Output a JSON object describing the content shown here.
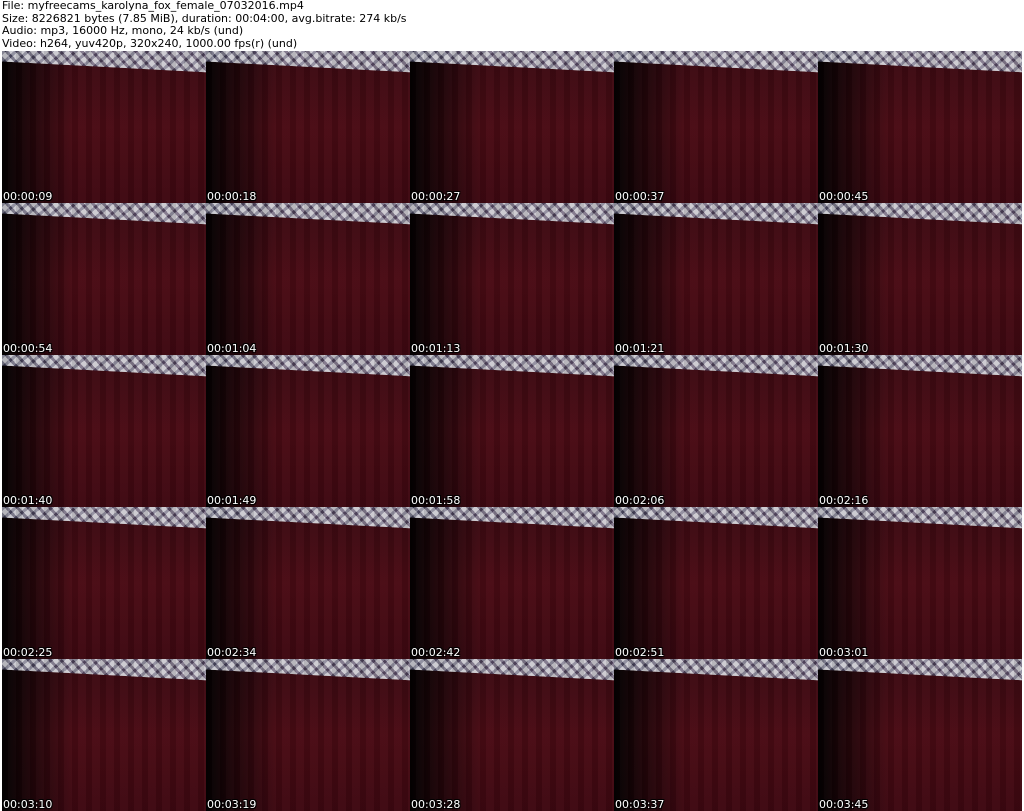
{
  "header": {
    "file_line": "File: myfreecams_karolyna_fox_female_07032016.mp4",
    "size_line": "Size: 8226821 bytes (7.85 MiB), duration: 00:04:00, avg.bitrate: 274 kb/s",
    "audio_line": "Audio: mp3, 16000 Hz, mono, 24 kb/s (und)",
    "video_line": "Video: h264, yuv420p, 320x240, 1000.00 fps(r) (und)"
  },
  "thumbnails": [
    "00:00:09",
    "00:00:18",
    "00:00:27",
    "00:00:37",
    "00:00:45",
    "00:00:54",
    "00:01:04",
    "00:01:13",
    "00:01:21",
    "00:01:30",
    "00:01:40",
    "00:01:49",
    "00:01:58",
    "00:02:06",
    "00:02:16",
    "00:02:25",
    "00:02:34",
    "00:02:42",
    "00:02:51",
    "00:03:01",
    "00:03:10",
    "00:03:19",
    "00:03:28",
    "00:03:37",
    "00:03:45"
  ]
}
